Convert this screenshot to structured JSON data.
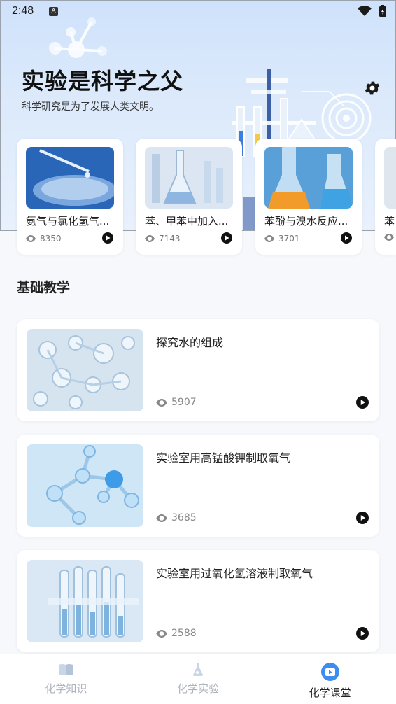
{
  "status_bar": {
    "time": "2:48",
    "notification_badge": "A"
  },
  "hero": {
    "title": "实验是科学之父",
    "subtitle": "科学研究是为了发展人类文明。"
  },
  "featured": [
    {
      "title": "氨气与氯化氢气体反应",
      "views": "8350"
    },
    {
      "title": "苯、甲苯中加入高锰酸钾",
      "views": "7143"
    },
    {
      "title": "苯酚与溴水反应实验",
      "views": "3701"
    },
    {
      "title": "苯",
      "views": ""
    }
  ],
  "section": {
    "title": "基础教学"
  },
  "lessons": [
    {
      "title": "探究水的组成",
      "views": "5907"
    },
    {
      "title": "实验室用高锰酸钾制取氧气",
      "views": "3685"
    },
    {
      "title": "实验室用过氧化氢溶液制取氧气",
      "views": "2588"
    }
  ],
  "nav": {
    "items": [
      {
        "label": "化学知识",
        "icon": "book-icon"
      },
      {
        "label": "化学实验",
        "icon": "flask-icon"
      },
      {
        "label": "化学课堂",
        "icon": "video-icon"
      }
    ],
    "active": "化学课堂"
  },
  "colors": {
    "accent": "#3d8cf0",
    "active_nav": "#222222",
    "inactive_nav": "#aeb4bd"
  }
}
